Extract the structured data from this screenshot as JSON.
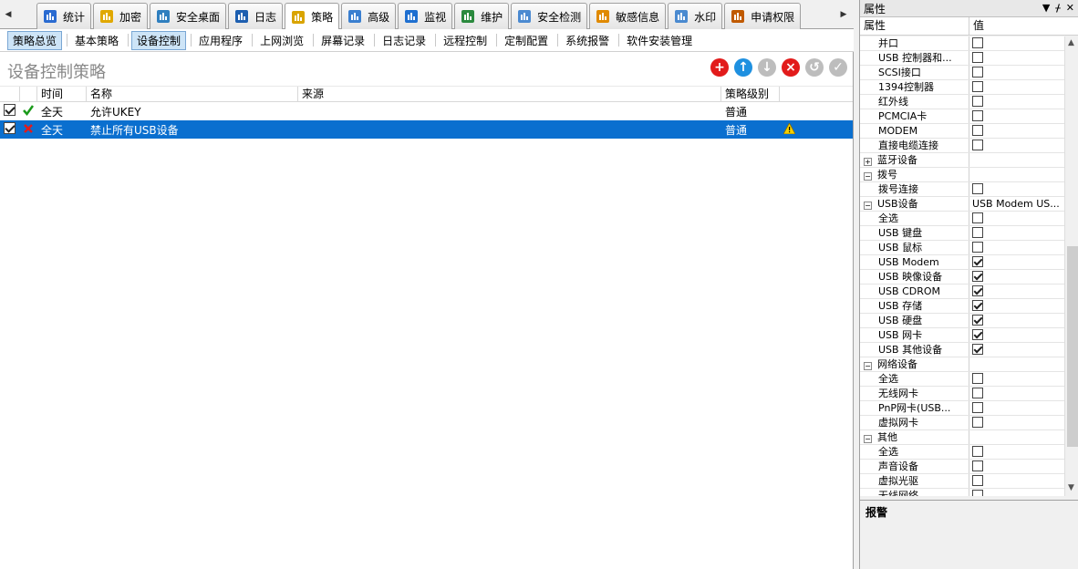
{
  "tabs": [
    {
      "label": "统计",
      "icon": "chart-icon"
    },
    {
      "label": "加密",
      "icon": "lock-icon"
    },
    {
      "label": "安全桌面",
      "icon": "desktop-icon"
    },
    {
      "label": "日志",
      "icon": "log-icon"
    },
    {
      "label": "策略",
      "icon": "policy-icon"
    },
    {
      "label": "高级",
      "icon": "users-icon"
    },
    {
      "label": "监视",
      "icon": "monitor-icon"
    },
    {
      "label": "维护",
      "icon": "maintain-icon"
    },
    {
      "label": "安全检测",
      "icon": "security-check-icon"
    },
    {
      "label": "敏感信息",
      "icon": "sensitive-icon"
    },
    {
      "label": "水印",
      "icon": "watermark-icon"
    },
    {
      "label": "申请权限",
      "icon": "request-icon"
    }
  ],
  "active_tab": "策略",
  "subnav": [
    "策略总览",
    "基本策略",
    "设备控制",
    "应用程序",
    "上网浏览",
    "屏幕记录",
    "日志记录",
    "远程控制",
    "定制配置",
    "系统报警",
    "软件安装管理"
  ],
  "subnav_selected": [
    "策略总览",
    "设备控制"
  ],
  "main": {
    "title": "设备控制策略",
    "columns": [
      "时间",
      "名称",
      "来源",
      "策略级别"
    ],
    "rows": [
      {
        "checked": true,
        "status": "allow",
        "time": "全天",
        "name": "允许UKEY",
        "source": "",
        "level": "普通",
        "warning": false,
        "selected": false
      },
      {
        "checked": true,
        "status": "deny",
        "time": "全天",
        "name": "禁止所有USB设备",
        "source": "",
        "level": "普通",
        "warning": true,
        "selected": true
      }
    ]
  },
  "props": {
    "title": "属性",
    "col_name": "属性",
    "col_value": "值",
    "rows": [
      {
        "name": "并口",
        "type": "check",
        "checked": false
      },
      {
        "name": "USB 控制器和...",
        "type": "check",
        "checked": false
      },
      {
        "name": "SCSI接口",
        "type": "check",
        "checked": false
      },
      {
        "name": "1394控制器",
        "type": "check",
        "checked": false
      },
      {
        "name": "红外线",
        "type": "check",
        "checked": false
      },
      {
        "name": "PCMCIA卡",
        "type": "check",
        "checked": false
      },
      {
        "name": "MODEM",
        "type": "check",
        "checked": false
      },
      {
        "name": "直接电缆连接",
        "type": "check",
        "checked": false
      },
      {
        "name": "蓝牙设备",
        "type": "cat",
        "expanded": false
      },
      {
        "name": "拨号",
        "type": "cat",
        "expanded": true
      },
      {
        "name": "拨号连接",
        "type": "check",
        "checked": false
      },
      {
        "name": "USB设备",
        "type": "cat",
        "expanded": true,
        "value": "USB Modem US..."
      },
      {
        "name": "全选",
        "type": "check",
        "checked": false
      },
      {
        "name": "USB 键盘",
        "type": "check",
        "checked": false
      },
      {
        "name": "USB 鼠标",
        "type": "check",
        "checked": false
      },
      {
        "name": "USB Modem",
        "type": "check",
        "checked": true
      },
      {
        "name": "USB 映像设备",
        "type": "check",
        "checked": true
      },
      {
        "name": "USB CDROM",
        "type": "check",
        "checked": true
      },
      {
        "name": "USB 存储",
        "type": "check",
        "checked": true
      },
      {
        "name": "USB 硬盘",
        "type": "check",
        "checked": true
      },
      {
        "name": "USB 网卡",
        "type": "check",
        "checked": true
      },
      {
        "name": "USB 其他设备",
        "type": "check",
        "checked": true
      },
      {
        "name": "网络设备",
        "type": "cat",
        "expanded": true
      },
      {
        "name": "全选",
        "type": "check",
        "checked": false
      },
      {
        "name": "无线网卡",
        "type": "check",
        "checked": false
      },
      {
        "name": "PnP网卡(USB...",
        "type": "check",
        "checked": false
      },
      {
        "name": "虚拟网卡",
        "type": "check",
        "checked": false
      },
      {
        "name": "其他",
        "type": "cat",
        "expanded": true
      },
      {
        "name": "全选",
        "type": "check",
        "checked": false
      },
      {
        "name": "声音设备",
        "type": "check",
        "checked": false
      },
      {
        "name": "虚拟光驱",
        "type": "check",
        "checked": false
      },
      {
        "name": "无线网络",
        "type": "check",
        "checked": false
      }
    ],
    "description": "报警"
  },
  "colors": {
    "selection": "#0a6fcf",
    "add": "#e21b1b",
    "up": "#1e90e0",
    "delete": "#e21b1b",
    "disabled": "#bdbdbd"
  }
}
